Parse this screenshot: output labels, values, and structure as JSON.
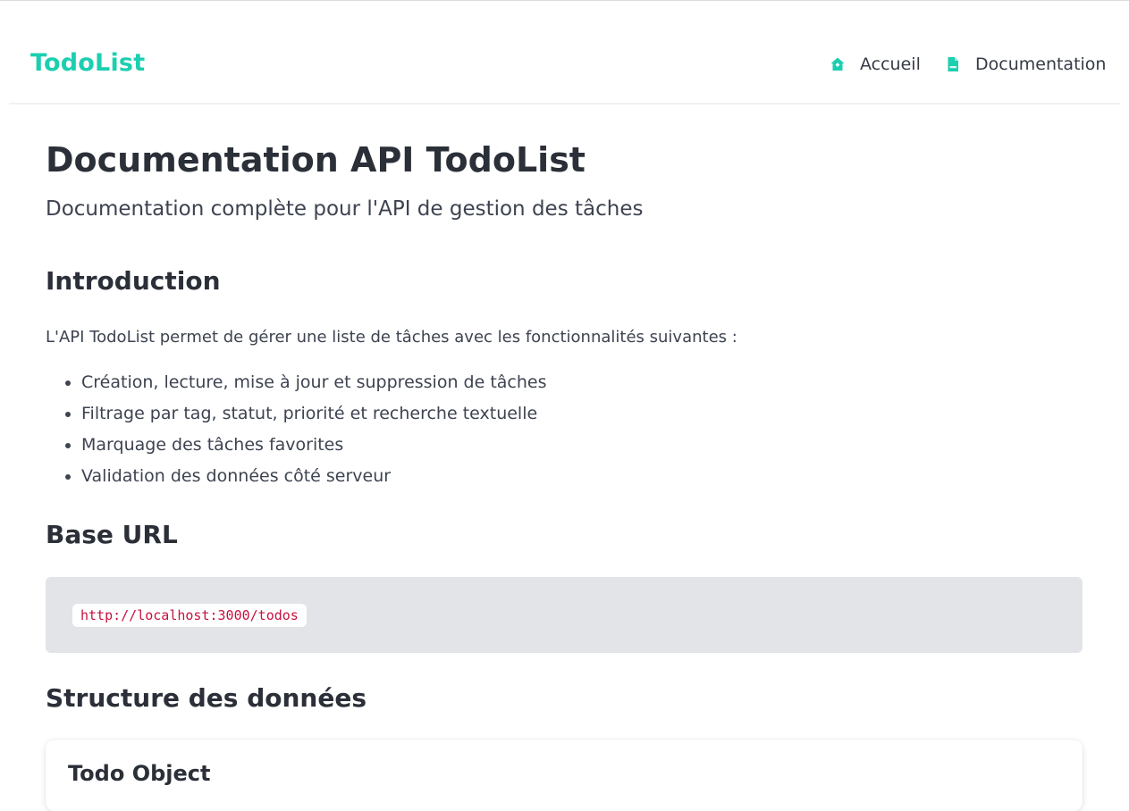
{
  "header": {
    "brand": "TodoList",
    "nav": [
      {
        "label": "Accueil",
        "icon": "home-icon"
      },
      {
        "label": "Documentation",
        "icon": "file-doc-icon"
      }
    ],
    "accent_color": "#1bcfb0"
  },
  "main": {
    "title": "Documentation API TodoList",
    "subtitle": "Documentation complète pour l'API de gestion des tâches",
    "intro": {
      "heading": "Introduction",
      "text": "L'API TodoList permet de gérer une liste de tâches avec les fonctionnalités suivantes :",
      "features": [
        "Création, lecture, mise à jour et suppression de tâches",
        "Filtrage par tag, statut, priorité et recherche textuelle",
        "Marquage des tâches favorites",
        "Validation des données côté serveur"
      ]
    },
    "base_url": {
      "heading": "Base URL",
      "url": "http://localhost:3000/todos"
    },
    "data_structure": {
      "heading": "Structure des données",
      "card_title": "Todo Object"
    }
  }
}
